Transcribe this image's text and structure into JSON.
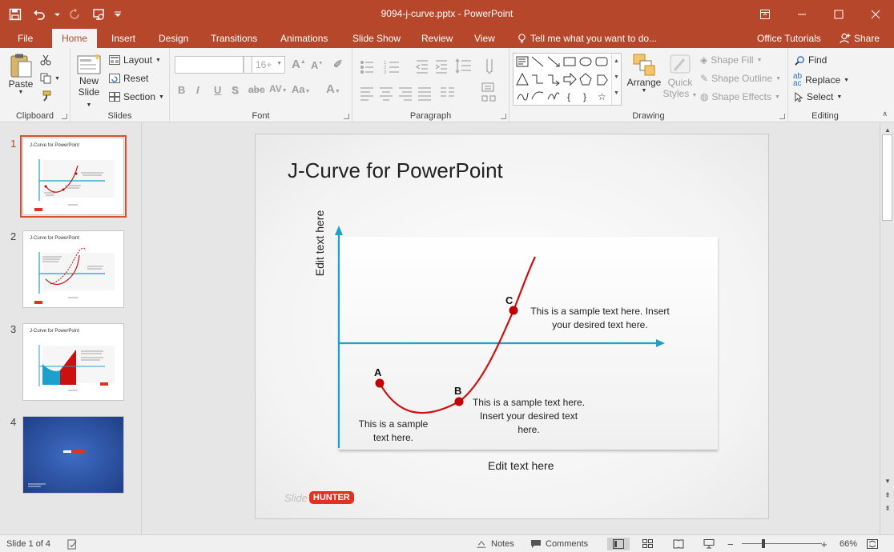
{
  "window": {
    "title": "9094-j-curve.pptx - PowerPoint"
  },
  "tabs": [
    {
      "label": "File"
    },
    {
      "label": "Home"
    },
    {
      "label": "Insert"
    },
    {
      "label": "Design"
    },
    {
      "label": "Transitions"
    },
    {
      "label": "Animations"
    },
    {
      "label": "Slide Show"
    },
    {
      "label": "Review"
    },
    {
      "label": "View"
    }
  ],
  "tell_me": "Tell me what you want to do...",
  "office_tutorials": "Office Tutorials",
  "share_label": "Share",
  "ribbon": {
    "clipboard": {
      "label": "Clipboard",
      "paste": "Paste"
    },
    "slides": {
      "label": "Slides",
      "new_slide_1": "New",
      "new_slide_2": "Slide",
      "layout": "Layout",
      "reset": "Reset",
      "section": "Section"
    },
    "font": {
      "label": "Font",
      "size_placeholder": "16+"
    },
    "paragraph": {
      "label": "Paragraph"
    },
    "drawing": {
      "label": "Drawing",
      "arrange": "Arrange",
      "quick_styles_1": "Quick",
      "quick_styles_2": "Styles",
      "shape_fill": "Shape Fill",
      "shape_outline": "Shape Outline",
      "shape_effects": "Shape Effects"
    },
    "editing": {
      "label": "Editing",
      "find": "Find",
      "replace": "Replace",
      "select": "Select"
    }
  },
  "thumbnails": [
    {
      "num": "1",
      "title": "J-Curve for PowerPoint"
    },
    {
      "num": "2",
      "title": "J-Curve for PowerPoint"
    },
    {
      "num": "3",
      "title": "J-Curve for PowerPoint"
    },
    {
      "num": "4",
      "title": ""
    }
  ],
  "slide": {
    "title": "J-Curve for PowerPoint",
    "y_label": "Edit text here",
    "x_label": "Edit text here",
    "points": {
      "a": "A",
      "b": "B",
      "c": "C"
    },
    "callout_a_1": "This is a sample",
    "callout_a_2": "text here.",
    "callout_b_1": "This is a sample text here.",
    "callout_b_2": "Insert your desired text",
    "callout_b_3": "here.",
    "callout_c_1": "This is a sample text here. Insert",
    "callout_c_2": "your desired text here.",
    "logo_slide": "Slide",
    "logo_hunter": "HUNTER",
    "colors": {
      "axis": "#1ba1cc",
      "curve": "#cc1010",
      "point": "#c00000"
    }
  },
  "status": {
    "slide_of": "Slide 1 of 4",
    "notes": "Notes",
    "comments": "Comments",
    "zoom": "66%"
  }
}
